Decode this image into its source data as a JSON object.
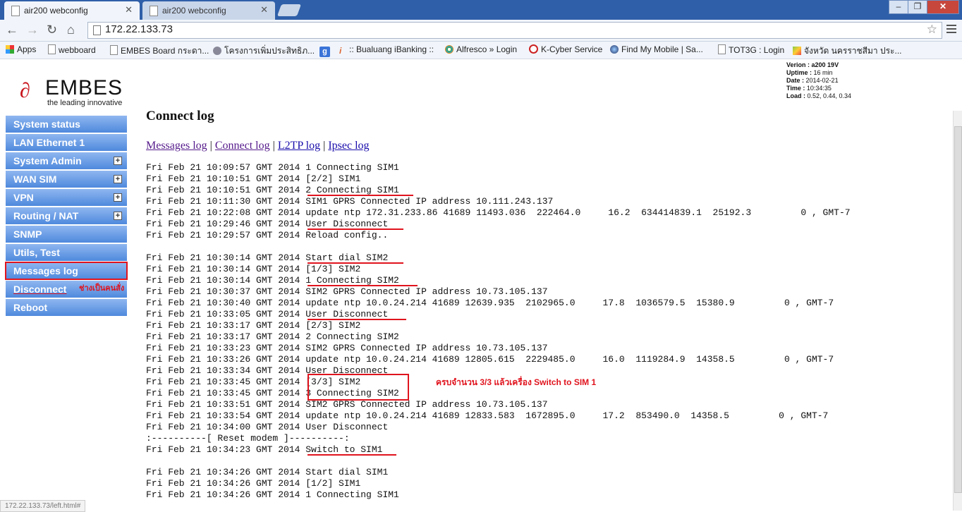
{
  "browser": {
    "tabs": [
      {
        "title": "air200 webconfig"
      },
      {
        "title": "air200 webconfig"
      }
    ],
    "url": "172.22.133.73",
    "bookmarks": [
      {
        "label": "Apps",
        "icon": "apps-icon"
      },
      {
        "label": "webboard",
        "icon": "page-icon"
      },
      {
        "label": "EMBES Board กระดา...",
        "icon": "page-icon"
      },
      {
        "label": "โครงการเพิ่มประสิทธิภ...",
        "icon": "satellite-icon"
      },
      {
        "label": "",
        "icon": "google-icon"
      },
      {
        "label": ":: Bualuang iBanking ::",
        "icon": "info-icon"
      },
      {
        "label": "Alfresco » Login",
        "icon": "flower-icon"
      },
      {
        "label": "K-Cyber Service",
        "icon": "kbank-icon"
      },
      {
        "label": "Find My Mobile | Sa...",
        "icon": "globe-icon"
      },
      {
        "label": "TOT3G : Login",
        "icon": "page-icon"
      },
      {
        "label": "จังหวัด นครราชสีมา ประ...",
        "icon": "map-icon"
      }
    ],
    "status_url": "172.22.133.73/left.html#"
  },
  "logo": {
    "name": "EMBES",
    "tagline": "the leading innovative"
  },
  "version_info": {
    "version_label": "Verion :",
    "version": "a200 19V",
    "uptime_label": "Uptime :",
    "uptime": "16 min",
    "date_label": "Date :",
    "date": "2014-02-21",
    "time_label": "Time :",
    "time": "10:34:35",
    "load_label": "Load :",
    "load": "0.52, 0.44, 0.34"
  },
  "sidebar": {
    "items": [
      {
        "label": "System status"
      },
      {
        "label": "LAN Ethernet 1"
      },
      {
        "label": "System Admin"
      },
      {
        "label": "WAN SIM"
      },
      {
        "label": "VPN"
      },
      {
        "label": "Routing / NAT"
      },
      {
        "label": "SNMP"
      },
      {
        "label": "Utils, Test"
      },
      {
        "label": "Messages log"
      },
      {
        "label": "Disconnect"
      },
      {
        "label": "Reboot"
      }
    ],
    "note": "ช่างเป็นคนสั่ง"
  },
  "page": {
    "title": "Connect log",
    "links": [
      {
        "label": "Messages log"
      },
      {
        "label": "Connect log"
      },
      {
        "label": "L2TP log"
      },
      {
        "label": "Ipsec log"
      }
    ],
    "separator": "|",
    "annotation": "ครบจำนวน 3/3  แล้วเครื่อง Switch to SIM 1",
    "log_lines": [
      "Fri Feb 21 10:09:57 GMT 2014 1 Connecting SIM1",
      "Fri Feb 21 10:10:51 GMT 2014 [2/2] SIM1",
      "Fri Feb 21 10:10:51 GMT 2014 2 Connecting SIM1",
      "Fri Feb 21 10:11:30 GMT 2014 SIM1 GPRS Connected IP address 10.111.243.137",
      "Fri Feb 21 10:22:08 GMT 2014 update ntp 172.31.233.86 41689 11493.036  222464.0     16.2  634414839.1  25192.3         0 , GMT-7",
      "Fri Feb 21 10:29:46 GMT 2014 User Disconnect",
      "Fri Feb 21 10:29:57 GMT 2014 Reload config..",
      "",
      "Fri Feb 21 10:30:14 GMT 2014 Start dial SIM2",
      "Fri Feb 21 10:30:14 GMT 2014 [1/3] SIM2",
      "Fri Feb 21 10:30:14 GMT 2014 1 Connecting SIM2",
      "Fri Feb 21 10:30:37 GMT 2014 SIM2 GPRS Connected IP address 10.73.105.137",
      "Fri Feb 21 10:30:40 GMT 2014 update ntp 10.0.24.214 41689 12639.935  2102965.0     17.8  1036579.5  15380.9         0 , GMT-7",
      "Fri Feb 21 10:33:05 GMT 2014 User Disconnect",
      "Fri Feb 21 10:33:17 GMT 2014 [2/3] SIM2",
      "Fri Feb 21 10:33:17 GMT 2014 2 Connecting SIM2",
      "Fri Feb 21 10:33:23 GMT 2014 SIM2 GPRS Connected IP address 10.73.105.137",
      "Fri Feb 21 10:33:26 GMT 2014 update ntp 10.0.24.214 41689 12805.615  2229485.0     16.0  1119284.9  14358.5         0 , GMT-7",
      "Fri Feb 21 10:33:34 GMT 2014 User Disconnect",
      "Fri Feb 21 10:33:45 GMT 2014 [3/3] SIM2",
      "Fri Feb 21 10:33:45 GMT 2014 3 Connecting SIM2",
      "Fri Feb 21 10:33:51 GMT 2014 SIM2 GPRS Connected IP address 10.73.105.137",
      "Fri Feb 21 10:33:54 GMT 2014 update ntp 10.0.24.214 41689 12833.583  1672895.0     17.2  853490.0  14358.5         0 , GMT-7",
      "Fri Feb 21 10:34:00 GMT 2014 User Disconnect",
      ":----------[ Reset modem ]----------:",
      "Fri Feb 21 10:34:23 GMT 2014 Switch to SIM1",
      "",
      "Fri Feb 21 10:34:26 GMT 2014 Start dial SIM1",
      "Fri Feb 21 10:34:26 GMT 2014 [1/2] SIM1",
      "Fri Feb 21 10:34:26 GMT 2014 1 Connecting SIM1"
    ]
  }
}
